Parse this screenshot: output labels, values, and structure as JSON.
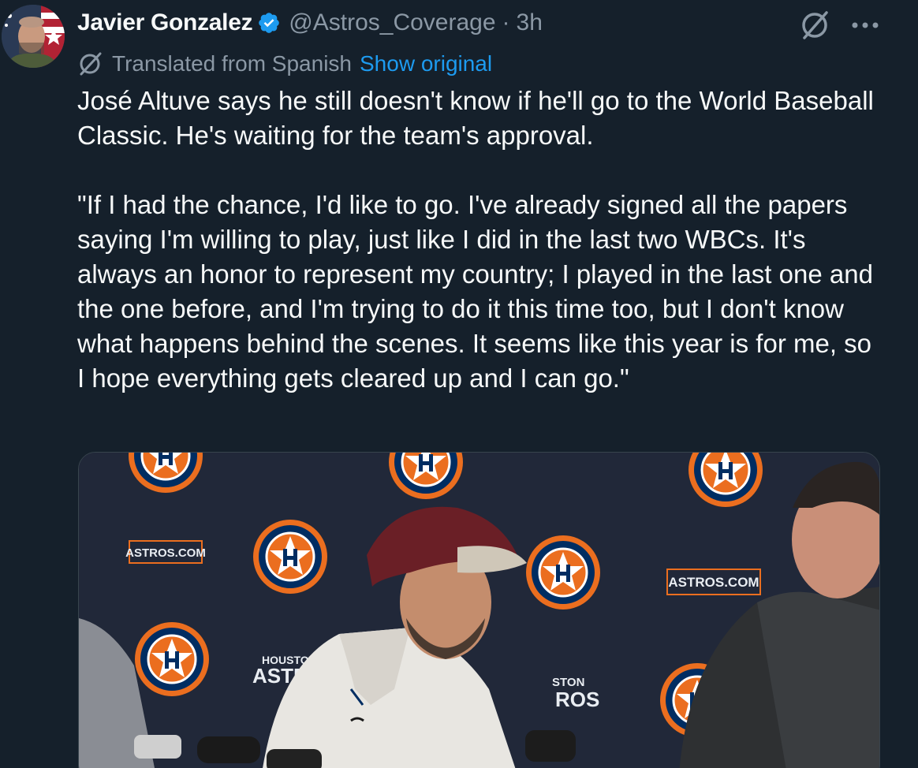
{
  "author": {
    "display_name": "Javier Gonzalez",
    "handle": "@Astros_Coverage",
    "separator": "·",
    "time": "3h",
    "verified": true
  },
  "translation": {
    "label": "Translated from Spanish",
    "show_original": "Show original"
  },
  "tweet": {
    "paragraph_1": "José Altuve says he still doesn't know if he'll go to the World Baseball Classic. He's waiting for the team's approval.",
    "paragraph_2": "\"If I had the chance, I'd like to go. I've already signed all the papers saying I'm willing to play, just like I did in the last two WBCs. It's always an honor to represent my country; I played in the last one and the one before, and I'm trying to do it this time too, but I don't know what happens behind the scenes. It seems like this year is for me, so I hope everything gets cleared up and I can go.\""
  },
  "media": {
    "backdrop_text_1": "ASTROS.COM",
    "backdrop_text_2": "ASTROS.COM",
    "backdrop_text_3": "HOUSTON",
    "backdrop_text_4": "ASTR",
    "backdrop_text_5": "STON",
    "backdrop_text_6": "ROS"
  },
  "icons": {
    "verified": "verified-badge-icon",
    "grok": "grok-icon",
    "more": "more-icon",
    "translate": "translate-icon"
  },
  "colors": {
    "background": "#15202b",
    "accent": "#1d9bf0",
    "secondary_text": "#8b98a5",
    "astros_orange": "#eb6e1f",
    "astros_navy": "#002d62"
  }
}
